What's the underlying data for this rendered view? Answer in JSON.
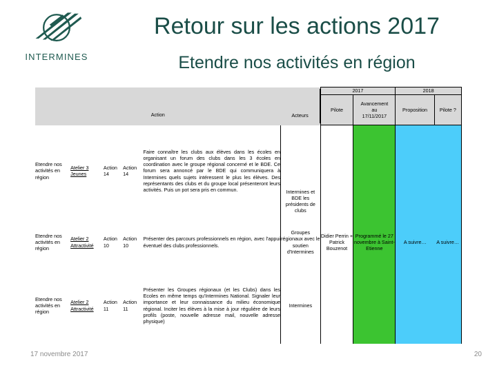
{
  "brand": {
    "logo_name": "intermines-logo",
    "logo_text": "INTERMINES",
    "logo_color": "#1f5a50"
  },
  "slide": {
    "title": "Retour sur les actions 2017",
    "subtitle": "Etendre nos activités en région",
    "title_color": "#1a4d47"
  },
  "table": {
    "group_headers": {
      "year_2017": "2017",
      "year_2018": "2018"
    },
    "columns": {
      "action": "Action",
      "acteurs": "Acteurs",
      "pilote": "Pilote",
      "avancement": "Avancement au 17/11/2017",
      "avancement_line1": "Avancement",
      "avancement_line2": "au",
      "avancement_line3": "17/11/2017",
      "proposition": "Proposition",
      "pilote_q": "Pilote ?"
    },
    "colors": {
      "header_band": "#d8d8d8",
      "green_cell": "#3cc431",
      "cyan_cell": "#4ccdfa"
    },
    "rows": [
      {
        "theme": "Etendre nos activités en région",
        "atelier": "Atelier 3 Jeunes",
        "atelier_line1": "Atelier 3",
        "atelier_line2": "Jeunes",
        "action_label": "Action 14",
        "action_label_line1": "Action",
        "action_label_line2": "14",
        "action_num": "Action 14",
        "action_num_line1": "Action",
        "action_num_line2": "14",
        "action_text": "Faire connaître les clubs aux élèves dans les écoles en organisant un forum des clubs dans les 3 écoles en coordination avec le groupe régional concerné et le BDE. Ce forum sera annoncé par le BDE qui communiquera à Intermines quels sujets intéressent le plus les élèves. Des représentants des clubs et du groupe local présenteront leurs activités. Puis un pot sera pris en commun.",
        "acteurs": "Intermines et BDE les présidents de clubs",
        "pilote": "",
        "avancement": "",
        "proposition": "",
        "pilote_q": ""
      },
      {
        "theme": "Etendre nos activités en région",
        "atelier": "Atelier 2 Attractivité",
        "atelier_line1": "Atelier 2",
        "atelier_line2": "Attractivité",
        "action_label": "Action 10",
        "action_label_line1": "Action",
        "action_label_line2": "10",
        "action_num": "Action 10",
        "action_num_line1": "Action",
        "action_num_line2": "10",
        "action_text": "Présenter des parcours professionnels en région, avec l'appui éventuel des clubs professionnels.",
        "acteurs": "Groupes régionaux avec le soutien d'Intermines",
        "pilote": "Didier Perrin + Patrick Bouzenot",
        "avancement": "Programmé le 27 novembre à Saint-Etienne",
        "proposition": "A suivre…",
        "pilote_q": "A suivre…"
      },
      {
        "theme": "Etendre nos activités en région",
        "atelier": "Atelier 2 Attractivité",
        "atelier_line1": "Atelier 2",
        "atelier_line2": "Attractivité",
        "action_label": "Action 11",
        "action_label_line1": "Action",
        "action_label_line2": "11",
        "action_num": "Action 11",
        "action_num_line1": "Action",
        "action_num_line2": "11",
        "action_text": "Présenter les Groupes régionaux (et les Clubs) dans les Ecoles en même temps qu'Intermines National. Signaler leur importance et leur connaissance du milieu économique régional. Inciter les élèves à la mise à jour régulière de leurs profils (poste, nouvelle adresse mail, nouvelle adresse physique)",
        "acteurs": "Intermines",
        "pilote": "",
        "avancement": "",
        "proposition": "",
        "pilote_q": ""
      }
    ]
  },
  "footer": {
    "date": "17 novembre 2017",
    "page_number": "20"
  }
}
